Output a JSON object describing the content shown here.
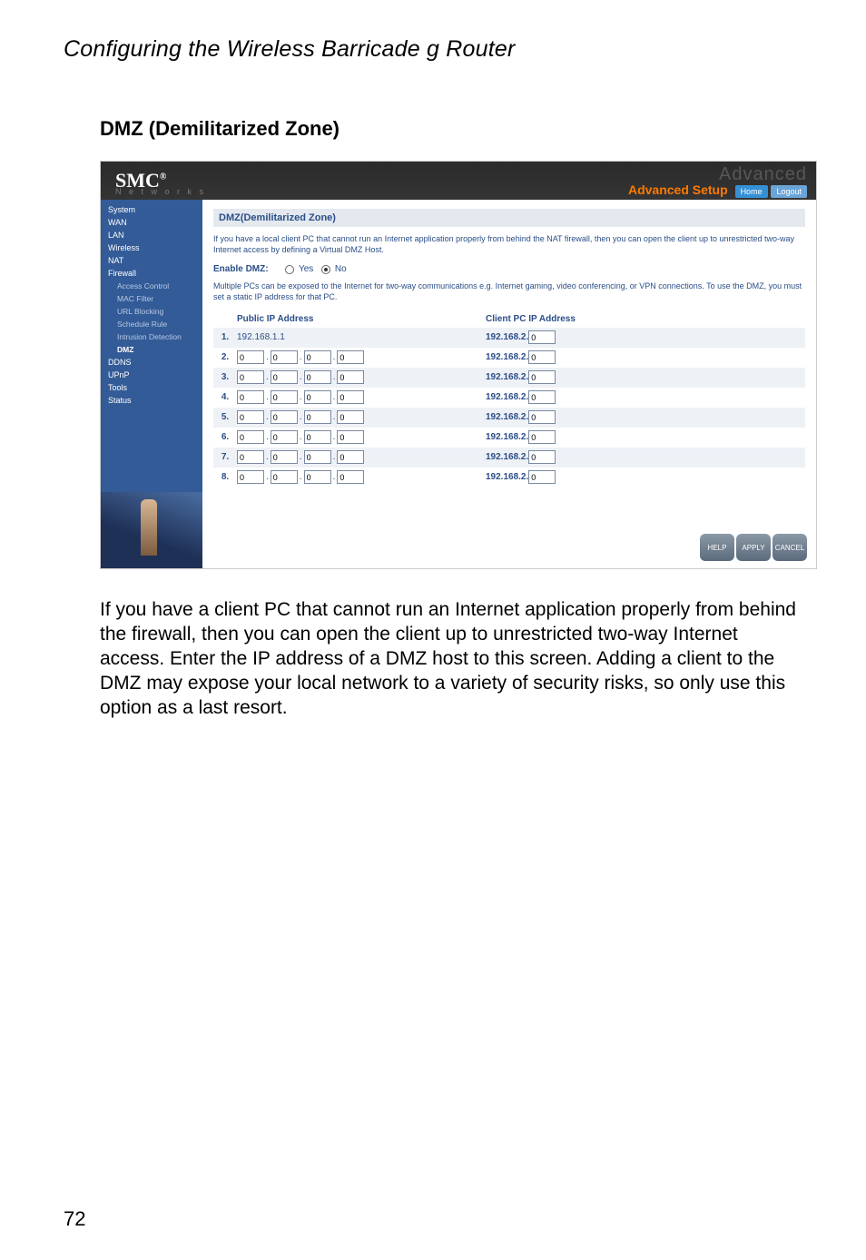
{
  "doc": {
    "header": "Configuring the Wireless Barricade g Router",
    "section": "DMZ (Demilitarized Zone)",
    "body": "If you have a client PC that cannot run an Internet application properly from behind the firewall, then you can open the client up to unrestricted two-way Internet access. Enter the IP address of a DMZ host to this screen. Adding a client to the DMZ may expose your local network to a variety of security risks, so only use this option as a last resort.",
    "pagenum": "72"
  },
  "ui": {
    "brand": "SMC",
    "brand_sub": "N e t w o r k s",
    "adv_ghost": "Advanced",
    "adv_setup": "Advanced Setup",
    "home": "Home",
    "logout": "Logout",
    "nav": {
      "system": "System",
      "wan": "WAN",
      "lan": "LAN",
      "wireless": "Wireless",
      "nat": "NAT",
      "firewall": "Firewall",
      "access": "Access Control",
      "mac": "MAC Filter",
      "url": "URL Blocking",
      "schedule": "Schedule Rule",
      "intrusion": "Intrusion Detection",
      "dmz": "DMZ",
      "ddns": "DDNS",
      "upnp": "UPnP",
      "tools": "Tools",
      "status": "Status"
    },
    "panel_title": "DMZ(Demilitarized Zone)",
    "note1": "If you have a local client PC that cannot run an Internet application properly from behind the NAT firewall, then you can open the client up to unrestricted two-way Internet access by defining a Virtual DMZ Host.",
    "enable_label": "Enable DMZ:",
    "yes": "Yes",
    "no": "No",
    "note2": "Multiple PCs can be exposed to the Internet for two-way communications e.g. Internet gaming, video conferencing, or VPN connections. To use the DMZ, you must set a static IP address for that PC.",
    "col_public": "Public IP Address",
    "col_client": "Client PC IP Address",
    "first_public": "192.168.1.1",
    "client_prefix": "192.168.2.",
    "zero": "0",
    "rows": [
      "1.",
      "2.",
      "3.",
      "4.",
      "5.",
      "6.",
      "7.",
      "8."
    ],
    "btn_help": "HELP",
    "btn_apply": "APPLY",
    "btn_cancel": "CANCEL"
  }
}
